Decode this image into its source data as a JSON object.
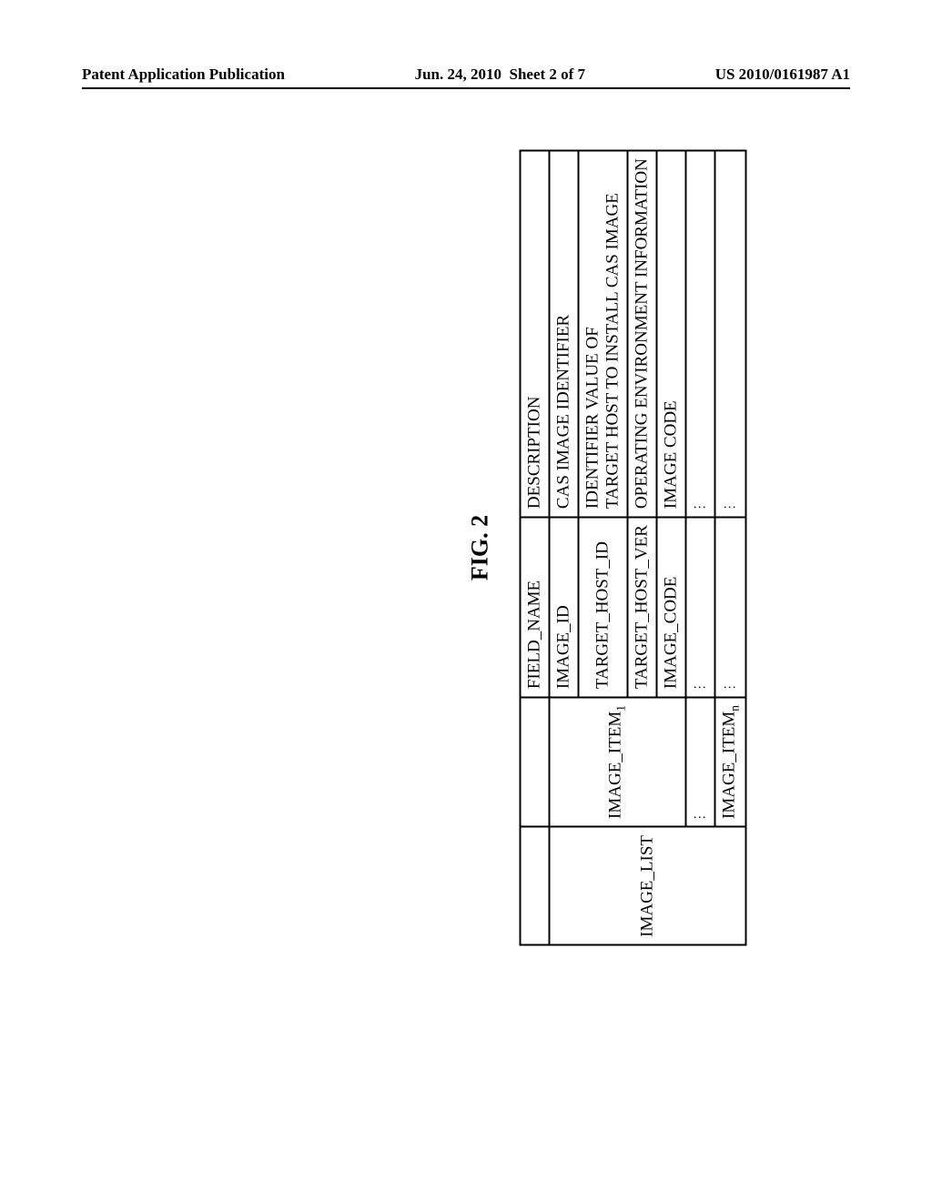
{
  "header": {
    "left": "Patent Application Publication",
    "center_date": "Jun. 24, 2010",
    "center_sheet": "Sheet 2 of 7",
    "right": "US 2010/0161987 A1"
  },
  "figure": {
    "label": "FIG. 2"
  },
  "table": {
    "headers": {
      "col1": "",
      "col2": "",
      "field_name": "FIELD_NAME",
      "description": "DESCRIPTION"
    },
    "rows": [
      {
        "col1": "IMAGE_LIST",
        "col2_prefix": "IMAGE_ITEM",
        "col2_sub": "1",
        "field": "IMAGE_ID",
        "desc": "CAS IMAGE IDENTIFIER"
      },
      {
        "field": "TARGET_HOST_ID",
        "desc_line1": "IDENTIFIER VALUE OF",
        "desc_line2": "TARGET HOST TO INSTALL CAS IMAGE"
      },
      {
        "field": "TARGET_HOST_VER",
        "desc": "OPERATING ENVIRONMENT INFORMATION"
      },
      {
        "field": "IMAGE_CODE",
        "desc": "IMAGE CODE"
      },
      {
        "col2_prefix": "IMAGE_ITEM",
        "col2_sub": "n"
      }
    ]
  }
}
